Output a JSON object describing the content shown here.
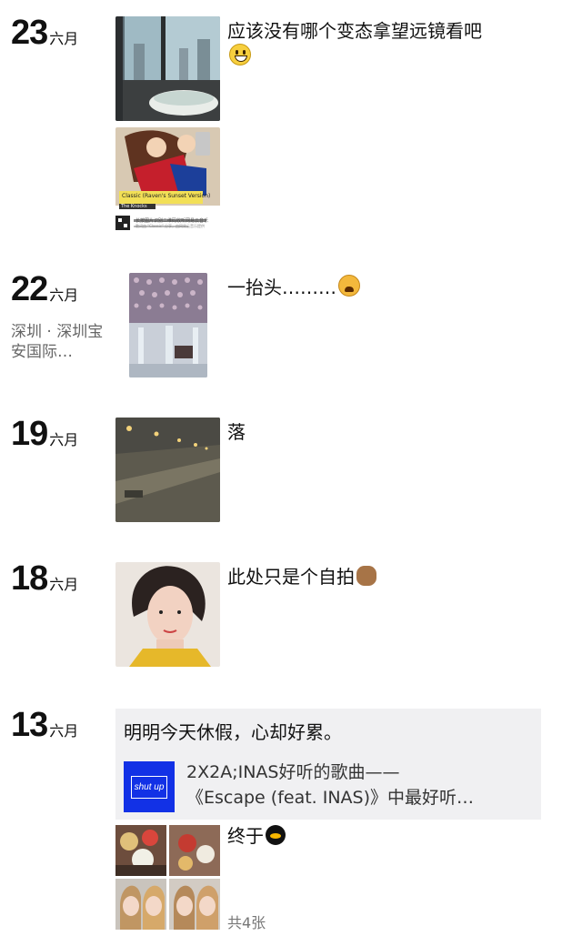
{
  "entries": [
    {
      "day": "23",
      "month": "六月",
      "caption": "应该没有哪个变态拿望远镜看吧",
      "emoji": "grinning-face-icon",
      "shared_thumb": {
        "title": "Classic (Raven's Sunset Version)",
        "artist": "The Knocks",
        "footer": "长按图片识别二维码收听网易云音乐",
        "sub": "歌词由 \"Classic\" 分享，由网易云音乐提供"
      }
    },
    {
      "day": "22",
      "month": "六月",
      "location": "深圳 · 深圳宝安国际…",
      "caption": "一抬头………",
      "emoji": "weary-face-icon"
    },
    {
      "day": "19",
      "month": "六月",
      "caption": "落"
    },
    {
      "day": "18",
      "month": "六月",
      "caption": "此处只是个自拍",
      "emoji": "monkey-icon"
    },
    {
      "day": "13",
      "month": "六月",
      "share": {
        "text": "明明今天休假，心却好累。",
        "icon_label": "shut up",
        "title_line1": "2X2A;INAS好听的歌曲——",
        "title_line2": "《Escape (feat. INAS)》中最好听…"
      },
      "caption": "终于",
      "emoji": "penguin-icon",
      "count": "共4张"
    }
  ],
  "colors": {
    "share_bg": "#f0f0f2",
    "share_icon": "#1231e6",
    "location_text": "#666666"
  }
}
